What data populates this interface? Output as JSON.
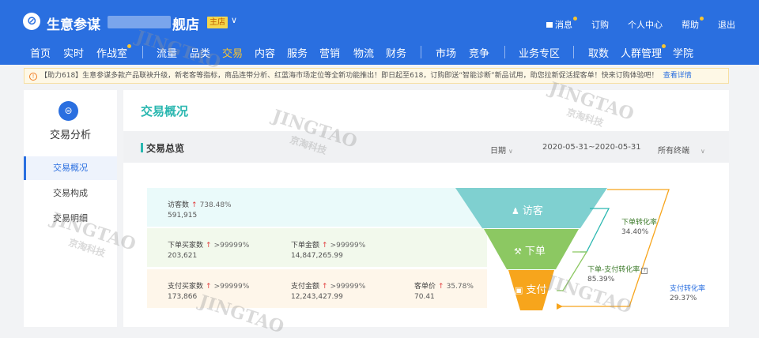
{
  "header": {
    "app_title": "生意参谋",
    "store_name_suffix": "舰店",
    "store_tag": "主店",
    "links": [
      "消息",
      "订购",
      "个人中心",
      "帮助",
      "退出"
    ]
  },
  "nav": {
    "items": [
      "首页",
      "实时",
      "作战室",
      "流量",
      "品类",
      "交易",
      "内容",
      "服务",
      "营销",
      "物流",
      "财务",
      "市场",
      "竞争",
      "业务专区",
      "取数",
      "人群管理",
      "学院"
    ],
    "active": "交易"
  },
  "notice": {
    "text": "【助力618】生意参谋多款产品联袂升级，新老客等指标，商品连带分析、红蓝海市场定位等全新功能推出！即日起至618，订购即送“智能诊断”新品试用，助您拉新促活提客单！快来订购体验吧！",
    "link": "查看详情"
  },
  "sidebar": {
    "title": "交易分析",
    "items": [
      "交易概况",
      "交易构成",
      "交易明细"
    ],
    "active": "交易概况"
  },
  "main": {
    "title": "交易概况",
    "section_label": "交易总览",
    "date_type": "日期",
    "date_range": "2020-05-31~2020-05-31",
    "terminal": "所有终端"
  },
  "metrics": {
    "visitors": {
      "name": "访客数",
      "change": "738.48%",
      "value": "591,915"
    },
    "order_buyers": {
      "name": "下单买家数",
      "change": ">99999%",
      "value": "203,621"
    },
    "order_amount": {
      "name": "下单金额",
      "change": ">99999%",
      "value": "14,847,265.99"
    },
    "pay_buyers": {
      "name": "支付买家数",
      "change": ">99999%",
      "value": "173,866"
    },
    "pay_amount": {
      "name": "支付金额",
      "change": ">99999%",
      "value": "12,243,427.99"
    },
    "unit_price": {
      "name": "客单价",
      "change": "35.78%",
      "value": "70.41"
    }
  },
  "funnel": {
    "stages": [
      "访客",
      "下单",
      "支付"
    ],
    "colors": {
      "visit": "#7fd0d0",
      "order": "#8cc862",
      "pay": "#f7a51c",
      "line_blue": "#2ab7b0",
      "line_green": "#8cc862",
      "line_orange": "#f7a51c",
      "up_arrow": "#e23c3c"
    },
    "conversions": {
      "order_rate": {
        "name": "下单转化率",
        "value": "34.40%"
      },
      "order_pay_rate": {
        "name": "下单-支付转化率",
        "value": "85.39%"
      },
      "pay_rate": {
        "name": "支付转化率",
        "value": "29.37%"
      }
    }
  },
  "watermark": {
    "en": "JINGTAO",
    "cn": "京淘科技"
  },
  "icons": {
    "logo": "compass-icon",
    "sidebar": "analysis-icon",
    "notice": "info-icon",
    "visit": "user-icon",
    "order": "hammer-icon",
    "pay": "wallet-icon"
  }
}
